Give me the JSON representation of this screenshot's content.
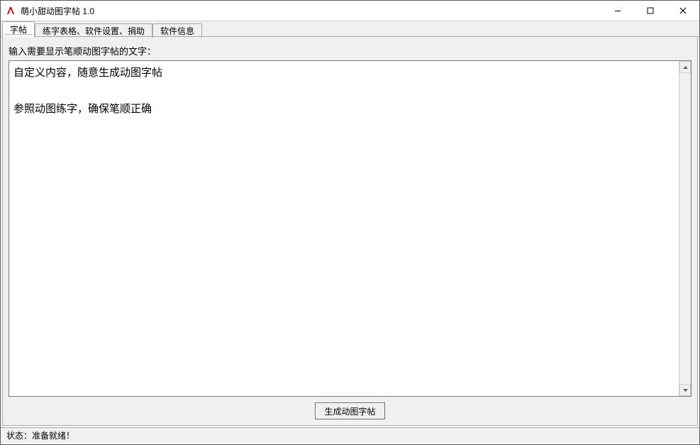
{
  "window": {
    "title": "萌小甜动图字帖 1.0"
  },
  "tabs": [
    {
      "label": "字帖",
      "active": true
    },
    {
      "label": "练字表格、软件设置、捐助",
      "active": false
    },
    {
      "label": "软件信息",
      "active": false
    }
  ],
  "main": {
    "prompt": "输入需要显示笔顺动图字帖的文字：",
    "textarea_value": "自定义内容，随意生成动图字帖\n\n参照动图练字，确保笔顺正确",
    "generate_button": "生成动图字帖"
  },
  "statusbar": {
    "text": "状态：准备就绪！"
  },
  "icons": {
    "app": "app-icon",
    "minimize": "minimize-icon",
    "maximize": "maximize-icon",
    "close": "close-icon",
    "scroll_up": "chevron-up-icon",
    "scroll_down": "chevron-down-icon"
  }
}
